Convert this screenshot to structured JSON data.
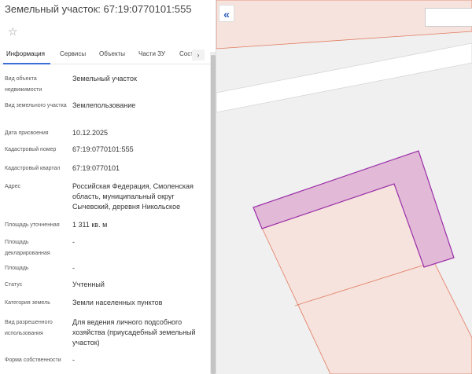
{
  "header": {
    "title": "Земельный участок: 67:19:0770101:555",
    "favorite_icon": "star-outline-icon"
  },
  "tabs": [
    {
      "label": "Информация",
      "active": true
    },
    {
      "label": "Сервисы"
    },
    {
      "label": "Объекты"
    },
    {
      "label": "Части ЗУ"
    },
    {
      "label": "Состо"
    }
  ],
  "tab_scroll_glyph": "›",
  "fields": [
    {
      "label": "Вид объекта недвижимости",
      "value": "Земельный участок"
    },
    {
      "label": "Вид земельного участка",
      "value": "Землепользование"
    },
    {
      "label": "Дата присвоения",
      "value": "10.12.2025"
    },
    {
      "label": "Кадастровый номер",
      "value": "67:19:0770101:555"
    },
    {
      "label": "Кадастровый квартал",
      "value": "67:19:0770101"
    },
    {
      "label": "Адрес",
      "value": "Российская Федерация, Смоленская область, муниципальный округ Сычевский, деревня Никольское"
    },
    {
      "label": "Площадь уточненная",
      "value": "1 311 кв. м"
    },
    {
      "label": "Площадь декларированная",
      "value": "-"
    },
    {
      "label": "Площадь",
      "value": "-"
    },
    {
      "label": "Статус",
      "value": "Учтенный"
    },
    {
      "label": "Категория земель",
      "value": "Земли населенных пунктов"
    },
    {
      "label": "Вид разрешенного использования",
      "value": "Для ведения личного подсобного хозяйства (приусадебный земельный участок)"
    },
    {
      "label": "Форма собственности",
      "value": "-"
    }
  ],
  "map": {
    "collapse_glyph": "«",
    "colors": {
      "background": "#f0f0f0",
      "parcel_fill": "#f6e3dd",
      "parcel_stroke": "#e07a5f",
      "selected_fill": "#e2bad7",
      "selected_stroke": "#9b2fa8",
      "road": "#ffffff"
    }
  }
}
